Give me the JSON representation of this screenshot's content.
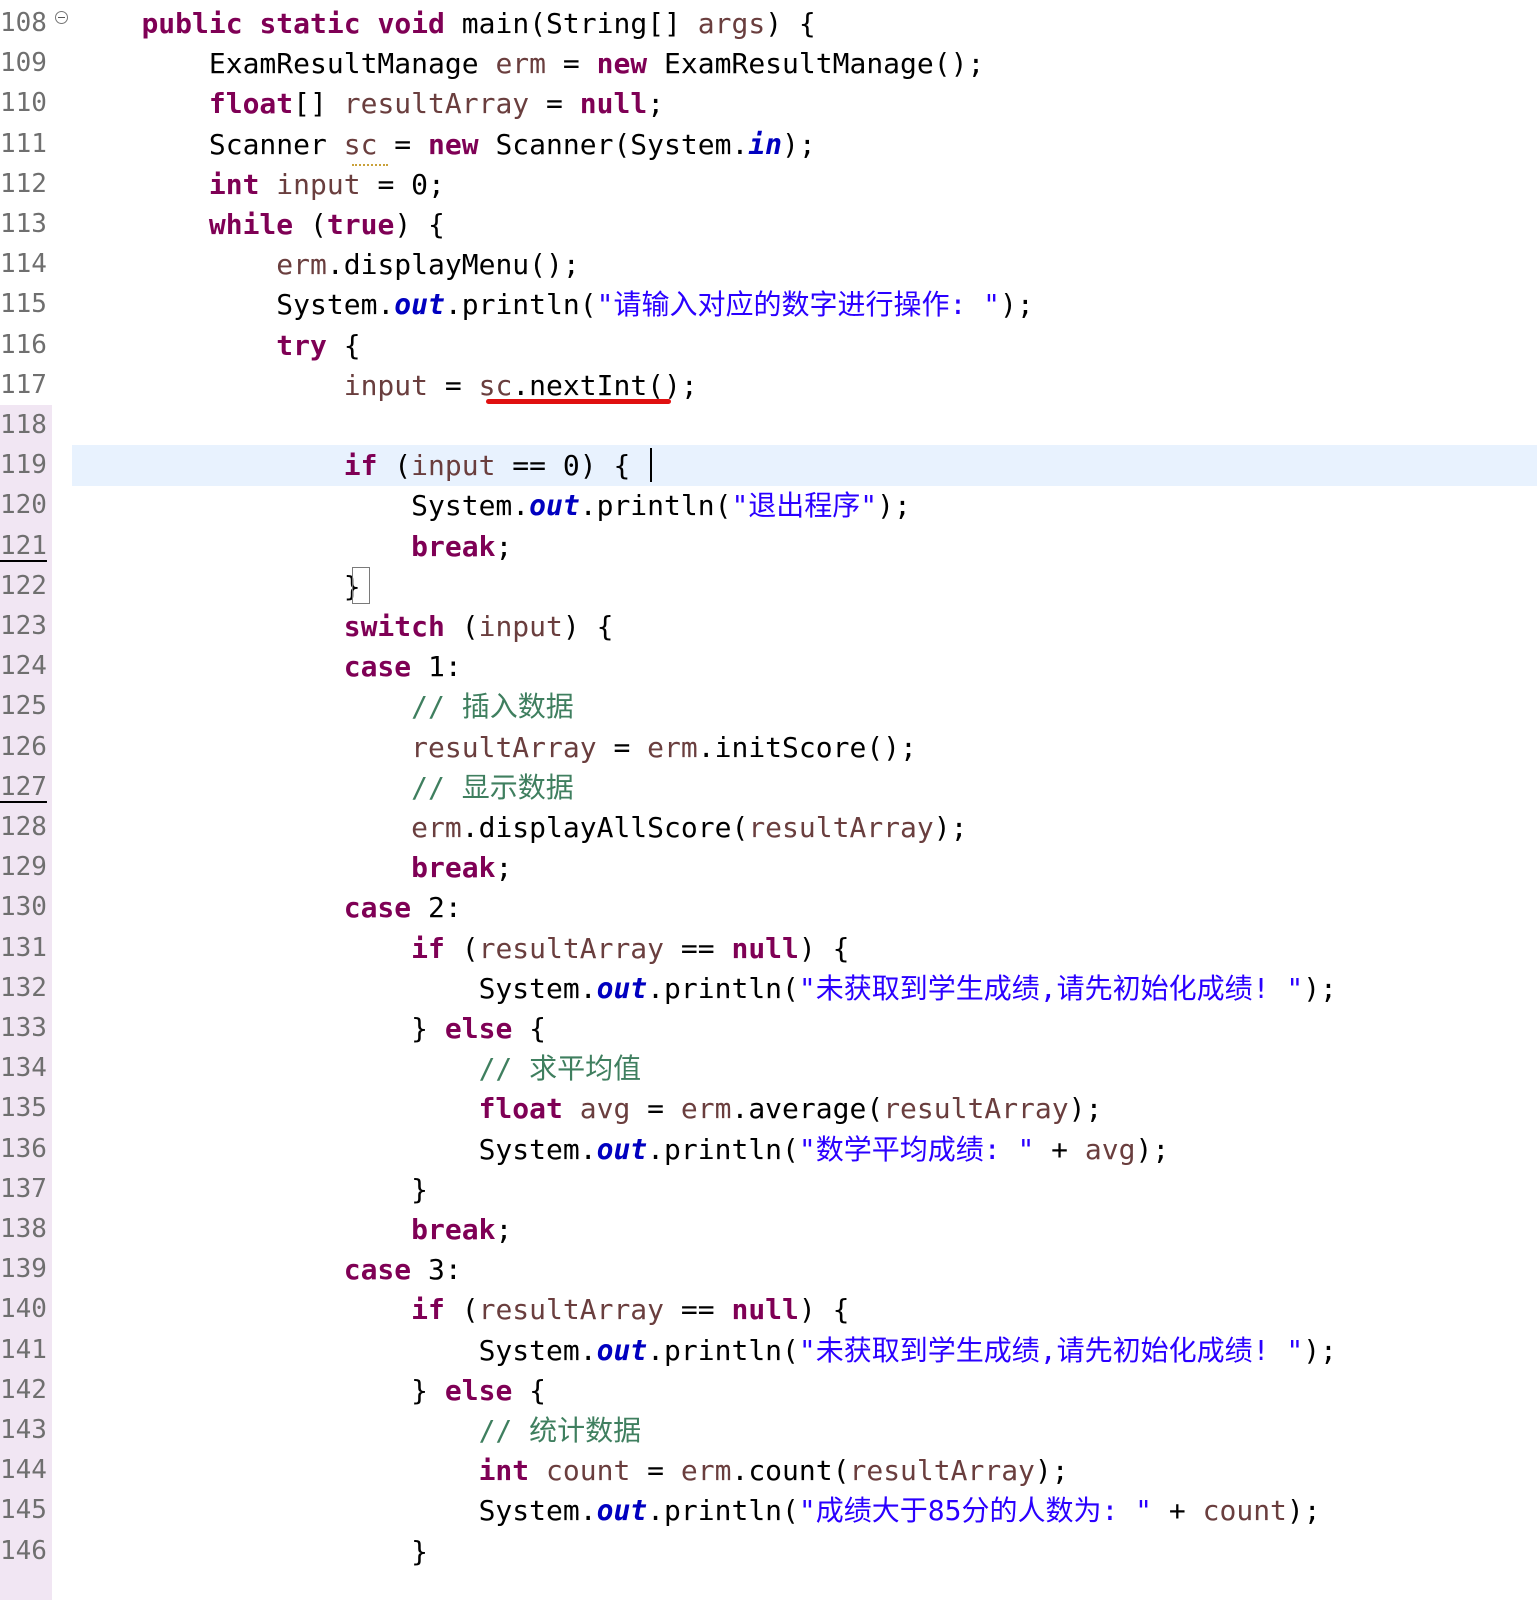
{
  "editor": {
    "lines": [
      {
        "number": "108",
        "text": "    public static void main(String[] args) {"
      },
      {
        "number": "109",
        "text": "        ExamResultManage erm = new ExamResultManage();"
      },
      {
        "number": "110",
        "text": "        float[] resultArray = null;"
      },
      {
        "number": "111",
        "text": "        Scanner sc = new Scanner(System.in);"
      },
      {
        "number": "112",
        "text": "        int input = 0;"
      },
      {
        "number": "113",
        "text": "        while (true) {"
      },
      {
        "number": "114",
        "text": "            erm.displayMenu();"
      },
      {
        "number": "115",
        "text": "            System.out.println(\"请输入对应的数字进行操作: \");"
      },
      {
        "number": "116",
        "text": "            try {"
      },
      {
        "number": "117",
        "text": "                input = sc.nextInt();"
      },
      {
        "number": "118",
        "text": ""
      },
      {
        "number": "119",
        "text": "                if (input == 0) {"
      },
      {
        "number": "120",
        "text": "                    System.out.println(\"退出程序\");"
      },
      {
        "number": "121",
        "text": "                    break;"
      },
      {
        "number": "122",
        "text": "                }"
      },
      {
        "number": "123",
        "text": "                switch (input) {"
      },
      {
        "number": "124",
        "text": "                case 1:"
      },
      {
        "number": "125",
        "text": "                    // 插入数据"
      },
      {
        "number": "126",
        "text": "                    resultArray = erm.initScore();"
      },
      {
        "number": "127",
        "text": "                    // 显示数据"
      },
      {
        "number": "128",
        "text": "                    erm.displayAllScore(resultArray);"
      },
      {
        "number": "129",
        "text": "                    break;"
      },
      {
        "number": "130",
        "text": "                case 2:"
      },
      {
        "number": "131",
        "text": "                    if (resultArray == null) {"
      },
      {
        "number": "132",
        "text": "                        System.out.println(\"未获取到学生成绩,请先初始化成绩! \");"
      },
      {
        "number": "133",
        "text": "                    } else {"
      },
      {
        "number": "134",
        "text": "                        // 求平均值"
      },
      {
        "number": "135",
        "text": "                        float avg = erm.average(resultArray);"
      },
      {
        "number": "136",
        "text": "                        System.out.println(\"数学平均成绩: \" + avg);"
      },
      {
        "number": "137",
        "text": "                    }"
      },
      {
        "number": "138",
        "text": "                    break;"
      },
      {
        "number": "139",
        "text": "                case 3:"
      },
      {
        "number": "140",
        "text": "                    if (resultArray == null) {"
      },
      {
        "number": "141",
        "text": "                        System.out.println(\"未获取到学生成绩,请先初始化成绩! \");"
      },
      {
        "number": "142",
        "text": "                    } else {"
      },
      {
        "number": "143",
        "text": "                        // 统计数据"
      },
      {
        "number": "144",
        "text": "                        int count = erm.count(resultArray);"
      },
      {
        "number": "145",
        "text": "                        System.out.println(\"成绩大于85分的人数为: \" + count);"
      },
      {
        "number": "146",
        "text": "                    }"
      }
    ]
  },
  "colors": {
    "keyword": "#7f0055",
    "local_variable": "#6a3e3e",
    "static_field": "#0000c0",
    "string": "#2a00ff",
    "comment": "#3f7f5f",
    "current_line": "#e8f2fe",
    "error_underline": "#e01010"
  },
  "icons": {
    "fold": "fold-collapse-icon"
  }
}
